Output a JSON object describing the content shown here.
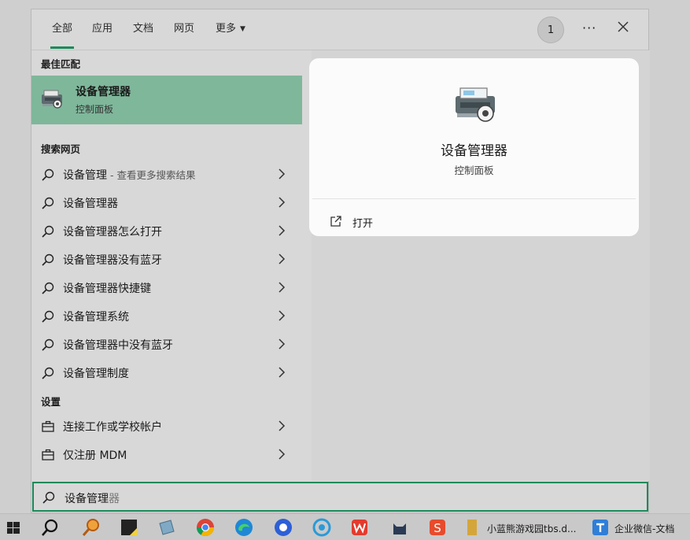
{
  "tabs": [
    {
      "label": "全部",
      "active": true
    },
    {
      "label": "应用"
    },
    {
      "label": "文档"
    },
    {
      "label": "网页"
    },
    {
      "label": "更多"
    }
  ],
  "header": {
    "badge": "1",
    "more_icon": "ellipsis-icon",
    "close_icon": "close-icon"
  },
  "left": {
    "best_match_label": "最佳匹配",
    "best_match": {
      "title": "设备管理器",
      "subtitle": "控制面板",
      "icon": "device-manager-icon"
    },
    "web_label": "搜索网页",
    "web_results": [
      {
        "text": "设备管理",
        "hint": " - 查看更多搜索结果"
      },
      {
        "text": "设备管理器"
      },
      {
        "text": "设备管理器怎么打开"
      },
      {
        "text": "设备管理器没有蓝牙"
      },
      {
        "text": "设备管理器快捷键"
      },
      {
        "text": "设备管理系统"
      },
      {
        "text": "设备管理器中没有蓝牙"
      },
      {
        "text": "设备管理制度"
      }
    ],
    "settings_label": "设置",
    "settings_results": [
      {
        "text": "连接工作或学校帐户",
        "icon": "briefcase-icon"
      },
      {
        "text": "仅注册 MDM",
        "icon": "briefcase-icon"
      }
    ]
  },
  "preview": {
    "title": "设备管理器",
    "subtitle": "控制面板",
    "action_label": "打开",
    "action_icon": "open-icon"
  },
  "search": {
    "typed": "设备管理",
    "completion": "器"
  },
  "taskbar": {
    "item1_label": "小蓝熊游戏园tbs.d...",
    "item2_label": "企业微信-文档"
  },
  "colors": {
    "accent": "#1b8a5a",
    "selected": "#7fb79b"
  }
}
